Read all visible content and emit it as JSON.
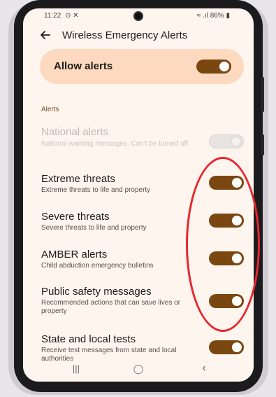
{
  "status_bar": {
    "time": "11:22",
    "status_icons": "⊙ ✕",
    "battery": "86%"
  },
  "header": {
    "back_icon": "arrow-left-icon",
    "title": "Wireless Emergency Alerts"
  },
  "allow_alerts": {
    "label": "Allow alerts",
    "enabled": true
  },
  "section": {
    "label": "Alerts"
  },
  "alerts": [
    {
      "title": "National alerts",
      "subtitle": "National warning messages. Can't be turned off.",
      "enabled": true,
      "disabled": true
    },
    {
      "title": "Extreme threats",
      "subtitle": "Extreme threats to life and property",
      "enabled": true,
      "disabled": false
    },
    {
      "title": "Severe threats",
      "subtitle": "Severe threats to life and property",
      "enabled": true,
      "disabled": false
    },
    {
      "title": "AMBER alerts",
      "subtitle": "Child abduction emergency bulletins",
      "enabled": true,
      "disabled": false
    },
    {
      "title": "Public safety messages",
      "subtitle": "Recommended actions that can save lives or property",
      "enabled": true,
      "disabled": false
    },
    {
      "title": "State and local tests",
      "subtitle": "Receive test messages from state and local authorities",
      "enabled": true,
      "disabled": false
    }
  ],
  "nav": {
    "recents": "|||",
    "home": "◯",
    "back": "‹"
  },
  "colors": {
    "accent": "#7b4711",
    "card": "#fcd9bf",
    "screen_bg": "#fdf5ee",
    "annotation": "#e8262e"
  }
}
